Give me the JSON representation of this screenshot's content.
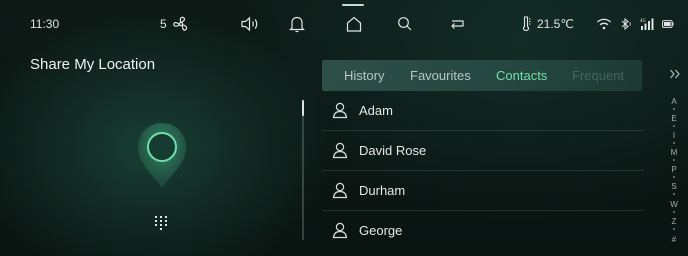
{
  "statusbar": {
    "time": "11:30",
    "fan_speed": "5",
    "fan_icon": "fan-icon",
    "volume_icon": "speaker-icon",
    "bell_icon": "bell-icon",
    "home_icon": "home-icon",
    "search_icon": "search-icon",
    "back_icon": "return-icon",
    "temperature": "21.5℃",
    "temperature_icon": "thermometer-icon",
    "wifi_icon": "wifi-icon",
    "bluetooth_icon": "bluetooth-icon",
    "signal_icon": "signal-icon",
    "battery_icon": "battery-icon"
  },
  "left_panel": {
    "title": "Share My Location",
    "pin_icon": "location-pin-icon",
    "keypad_icon": "dial-pad-icon"
  },
  "tabs": [
    {
      "label": "History",
      "active": false
    },
    {
      "label": "Favourites",
      "active": false
    },
    {
      "label": "Contacts",
      "active": true
    },
    {
      "label": "Frequent",
      "active": false
    }
  ],
  "tabs_more_icon": "double-chevron-right-icon",
  "contacts": [
    {
      "name": "Adam"
    },
    {
      "name": "David Rose"
    },
    {
      "name": "Durham"
    },
    {
      "name": "George"
    }
  ],
  "alpha_index": [
    "A",
    "E",
    "I",
    "M",
    "P",
    "S",
    "W",
    "Z",
    "#"
  ],
  "colors": {
    "accent": "#6fe0a8",
    "background": "#0b1512",
    "tab_bar": "#46786e"
  }
}
